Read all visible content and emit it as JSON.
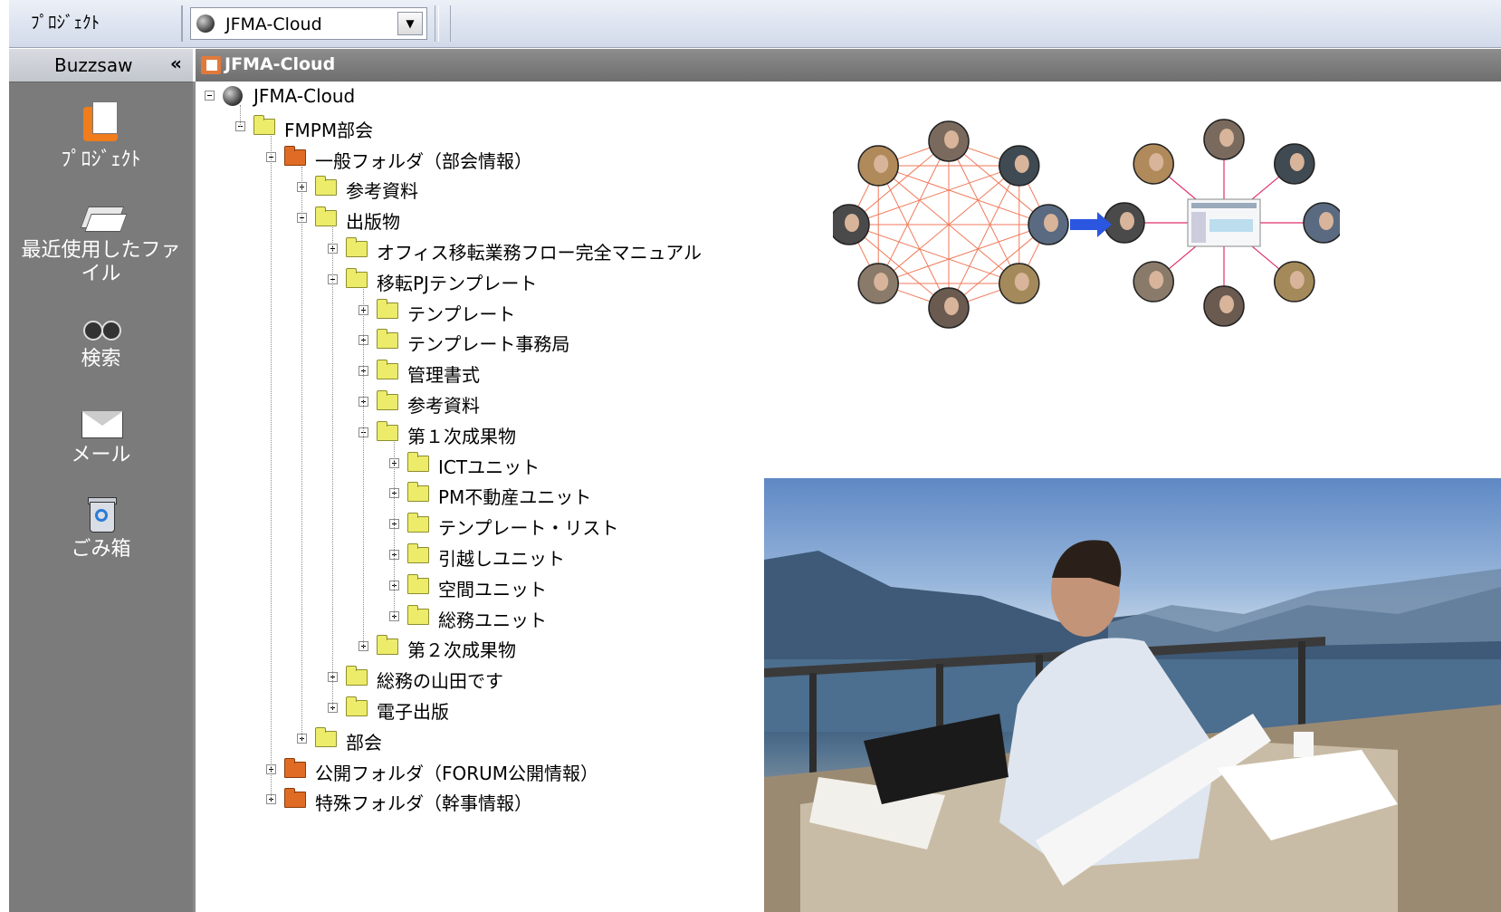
{
  "toolbar": {
    "project_label": "ﾌﾟﾛｼﾞｪｸﾄ",
    "project_select_value": "JFMA-Cloud"
  },
  "sidebar": {
    "title": "Buzzsaw",
    "collapse_glyph": "«",
    "items": [
      {
        "label": "ﾌﾟﾛｼﾞｪｸﾄ",
        "icon": "project-icon"
      },
      {
        "label": "最近使用したファイル",
        "icon": "recent-files-icon"
      },
      {
        "label": "検索",
        "icon": "binoculars-icon"
      },
      {
        "label": "メール",
        "icon": "mail-icon"
      },
      {
        "label": "ごみ箱",
        "icon": "recycle-bin-icon"
      }
    ]
  },
  "main": {
    "title": "JFMA-Cloud",
    "tree": [
      {
        "label": "JFMA-Cloud",
        "level": 0,
        "expanded": true,
        "icon": "globe"
      },
      {
        "label": "FMPM部会",
        "level": 1,
        "expanded": true,
        "icon": "folder"
      },
      {
        "label": "一般フォルダ（部会情報）",
        "level": 2,
        "expanded": true,
        "icon": "folder-orange"
      },
      {
        "label": "参考資料",
        "level": 3,
        "expanded": false,
        "icon": "folder"
      },
      {
        "label": "出版物",
        "level": 3,
        "expanded": true,
        "icon": "folder"
      },
      {
        "label": "オフィス移転業務フロー完全マニュアル",
        "level": 4,
        "expanded": false,
        "icon": "folder"
      },
      {
        "label": "移転PJテンプレート",
        "level": 4,
        "expanded": true,
        "icon": "folder"
      },
      {
        "label": "テンプレート",
        "level": 5,
        "expanded": false,
        "icon": "folder"
      },
      {
        "label": "テンプレート事務局",
        "level": 5,
        "expanded": false,
        "icon": "folder"
      },
      {
        "label": "管理書式",
        "level": 5,
        "expanded": false,
        "icon": "folder"
      },
      {
        "label": "参考資料",
        "level": 5,
        "expanded": false,
        "icon": "folder"
      },
      {
        "label": "第１次成果物",
        "level": 5,
        "expanded": true,
        "icon": "folder"
      },
      {
        "label": "ICTユニット",
        "level": 6,
        "expanded": false,
        "icon": "folder"
      },
      {
        "label": "PM不動産ユニット",
        "level": 6,
        "expanded": false,
        "icon": "folder"
      },
      {
        "label": "テンプレート・リスト",
        "level": 6,
        "expanded": false,
        "icon": "folder"
      },
      {
        "label": "引越しユニット",
        "level": 6,
        "expanded": false,
        "icon": "folder"
      },
      {
        "label": "空間ユニット",
        "level": 6,
        "expanded": false,
        "icon": "folder"
      },
      {
        "label": "総務ユニット",
        "level": 6,
        "expanded": false,
        "icon": "folder"
      },
      {
        "label": "第２次成果物",
        "level": 5,
        "expanded": false,
        "icon": "folder"
      },
      {
        "label": "総務の山田です",
        "level": 4,
        "expanded": false,
        "icon": "folder"
      },
      {
        "label": "電子出版",
        "level": 4,
        "expanded": false,
        "icon": "folder"
      },
      {
        "label": "部会",
        "level": 3,
        "expanded": false,
        "icon": "folder"
      },
      {
        "label": "公開フォルダ（FORUM公開情報）",
        "level": 2,
        "expanded": false,
        "icon": "folder-orange"
      },
      {
        "label": "特殊フォルダ（幹事情報）",
        "level": 2,
        "expanded": false,
        "icon": "folder-orange"
      }
    ]
  },
  "colors": {
    "sidebar_bg": "#7b7b7b",
    "header_bg": "#7e7e7e",
    "network_lines": "#f07a5a",
    "hub_lines": "#e0306a",
    "arrow": "#2a56e0"
  }
}
